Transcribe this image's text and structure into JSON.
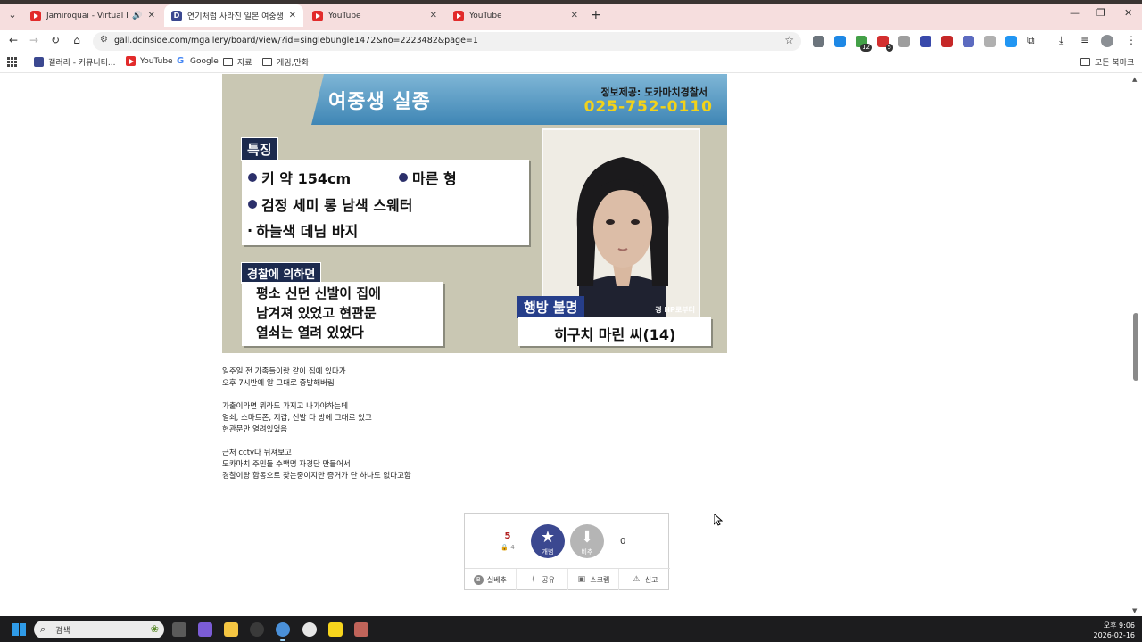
{
  "tabs": [
    {
      "title": "Jamiroquai - Virtual Insanity",
      "icon": "youtube-icon"
    },
    {
      "title": "연기처럼 사라진 일본 여중생",
      "icon": "dcinside-icon"
    },
    {
      "title": "YouTube",
      "icon": "youtube-icon"
    },
    {
      "title": "YouTube",
      "icon": "youtube-icon"
    }
  ],
  "address_bar": {
    "url": "gall.dcinside.com/mgallery/board/view/?id=singlebungle1472&no=2223482&page=1"
  },
  "bookmarks": {
    "items": [
      "갤러리 - 커뮤니티...",
      "YouTube",
      "Google",
      "자료",
      "게임,만화"
    ],
    "all_bookmarks": "모든 북마크"
  },
  "extension_badges": [
    "12",
    "5"
  ],
  "article_image": {
    "banner_title": "여중생 실종",
    "info_source": "정보제공: 도카마치경찰서",
    "phone": "025-752-0110",
    "features_label": "특징",
    "height": "키 약 154cm",
    "build": "마른 형",
    "top": "검정 세미 롱 남색 스웨터",
    "bottom": "하늘색 데님 바지",
    "police_label": "경찰에 의하면",
    "police_lines": [
      "평소 신던 신발이 집에",
      "남겨져 있었고 현관문",
      "열쇠는 열려 있었다"
    ],
    "photo_credit": "경 HP로부터",
    "missing_label": "행방 불명",
    "name": "히구치 마린 씨(14)"
  },
  "article_text": [
    "일주일 전 가족들이랑 같이 집에 있다가",
    "오후 7시반에 알 그대로 증발해버림",
    "",
    "가출이라면 뭐라도 가지고 나가야하는데",
    "열쇠, 스마트폰, 지갑, 신발 다 방에 그대로 있고",
    "현관문만 열려있었음",
    "",
    "근처 cctv다 뒤져보고",
    "도카마치 주민들 수백명 자경단 만들어서",
    "경찰이랑 합동으로 찾는중이지만 증거가 단 하나도 없다고함"
  ],
  "vote": {
    "up_count": "5",
    "fixed_count": "4",
    "up_label": "개념",
    "down_label": "비추",
    "down_count": "0",
    "actions": [
      "실베추",
      "공유",
      "스크랩",
      "신고"
    ]
  },
  "taskbar": {
    "search_placeholder": "검색",
    "time": "오후 9:06",
    "date": "2026-02-16"
  },
  "colors": {
    "tabbar_bg": "#f6dede",
    "accent": "#3b4890",
    "youtube_red": "#e22b2b",
    "phone_yellow": "#f2d21a"
  }
}
